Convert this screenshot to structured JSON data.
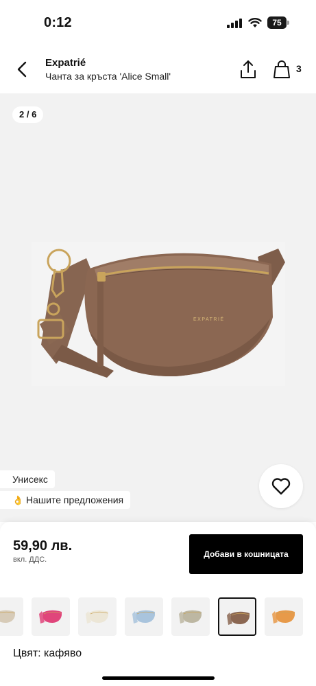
{
  "status_bar": {
    "time": "0:12",
    "battery": "75"
  },
  "header": {
    "brand": "Expatrié",
    "product_name": "Чанта за кръста 'Alice Small'",
    "cart_count": "3",
    "icons": {
      "back": "chevron-left",
      "share": "share-upload",
      "cart": "shopping-bag"
    }
  },
  "gallery": {
    "pager": "2 / 6",
    "bag_logo": "EXPATRIÉ",
    "tags": {
      "unisex": "Унисекс",
      "offers": "Нашите предложения",
      "offers_emoji": "👌"
    },
    "wishlist_icon": "heart-outline"
  },
  "purchase": {
    "price": "59,90 лв.",
    "vat_note": "вкл. ДДС.",
    "add_to_cart_label": "Добави в кошницата"
  },
  "variants": {
    "swatch_colors": [
      "#d7cbb8",
      "#e0457b",
      "#ece6d6",
      "#a9c4dd",
      "#bdb7a2",
      "#8b6752",
      "#e79a4a"
    ],
    "selected_index": 5,
    "color_label": "Цвят: кафяво"
  },
  "colors": {
    "accent": "#000000",
    "background": "#f2f2f2",
    "bag_brown": "#8b6752"
  }
}
